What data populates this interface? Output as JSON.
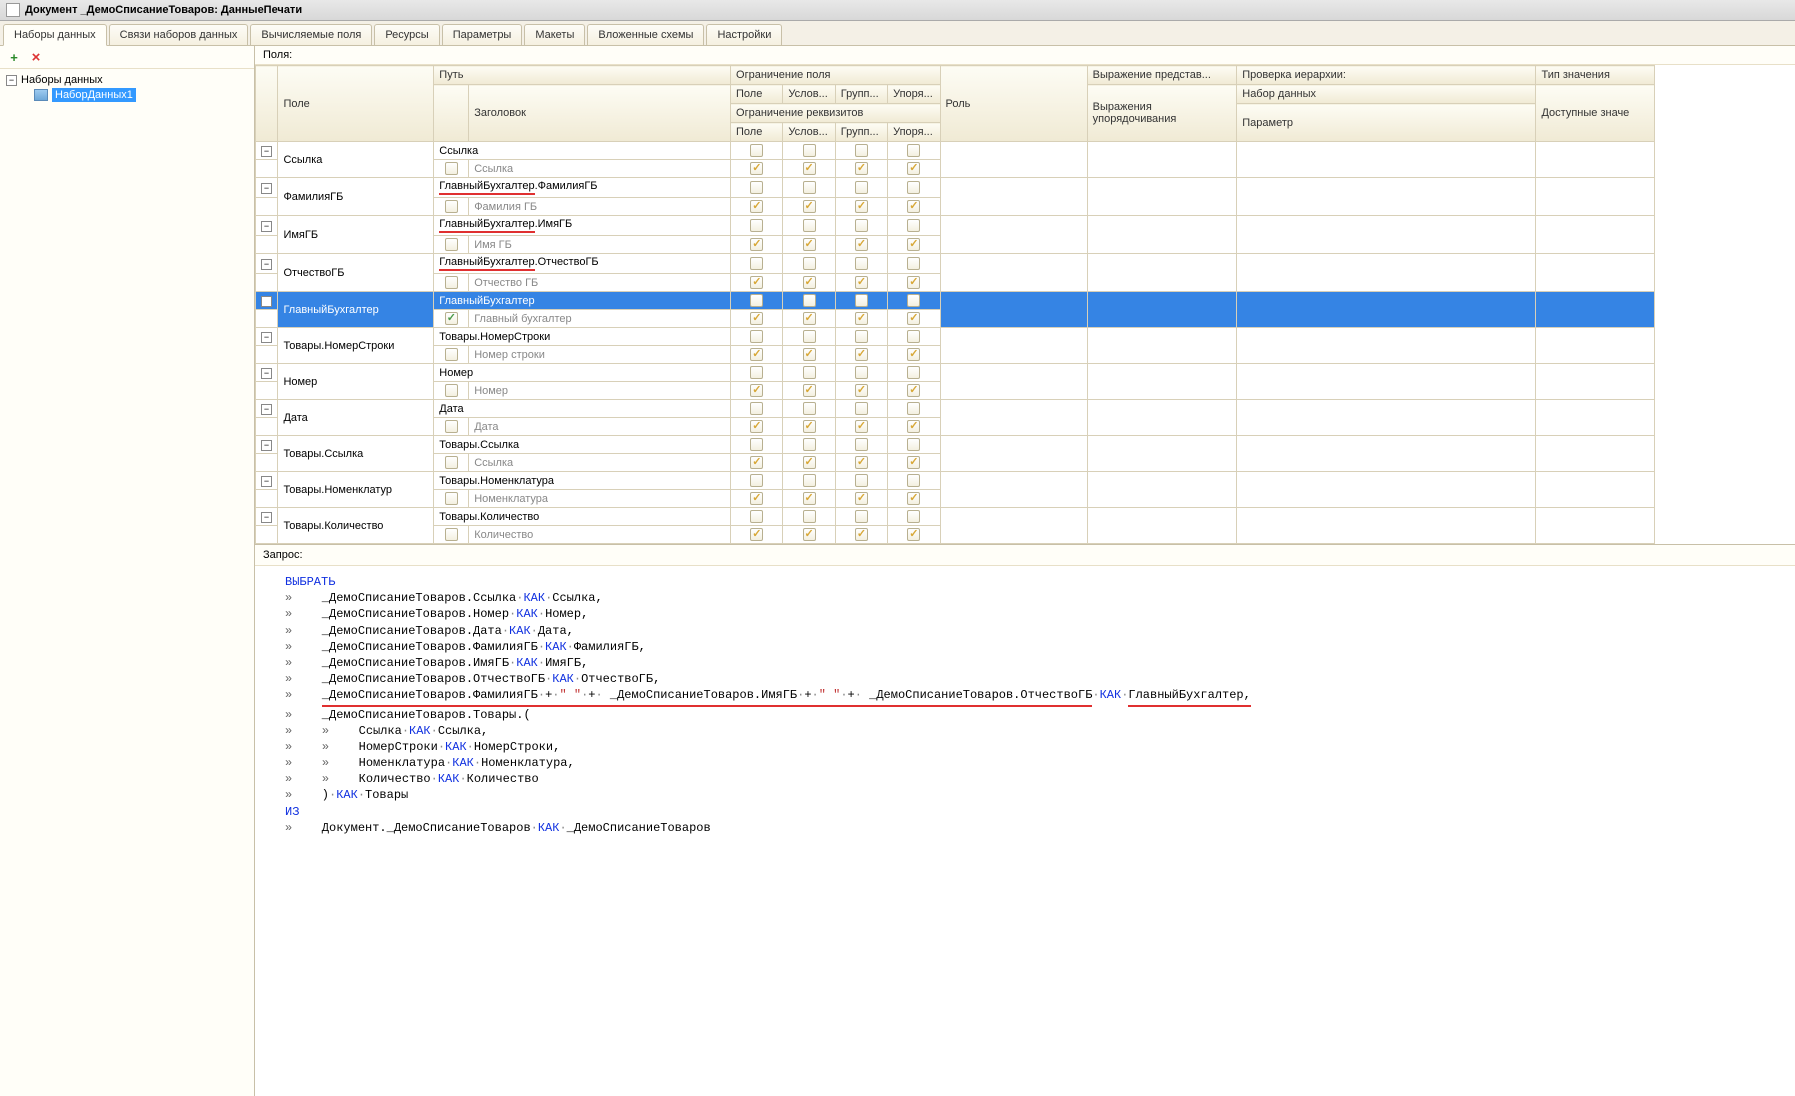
{
  "title": "Документ _ДемоСписаниеТоваров: ДанныеПечати",
  "tabs": [
    "Наборы данных",
    "Связи наборов данных",
    "Вычисляемые поля",
    "Ресурсы",
    "Параметры",
    "Макеты",
    "Вложенные схемы",
    "Настройки"
  ],
  "activeTab": 0,
  "tree": {
    "root": "Наборы данных",
    "child": "НаборДанных1"
  },
  "fieldsLabel": "Поля:",
  "headers": {
    "field": "Поле",
    "path": "Путь",
    "head": "Заголовок",
    "limField": "Ограничение поля",
    "role": "Роль",
    "exprPres": "Выражение представ...",
    "exprOrd": "Выражения упорядочивания",
    "hier": "Проверка иерархии:",
    "ds": "Набор данных",
    "param": "Параметр",
    "type": "Тип значения",
    "avail": "Доступные значе",
    "pole": "Поле",
    "uslov": "Услов...",
    "grupp": "Групп...",
    "uporya": "Упоря...",
    "limReq": "Ограничение реквизитов"
  },
  "rows": [
    {
      "field": "Ссылка",
      "path": "Ссылка",
      "sub": "Ссылка",
      "u": false,
      "cb1": [
        "",
        "",
        "",
        ""
      ],
      "cb2": [
        "c",
        "c",
        "c",
        "c"
      ]
    },
    {
      "field": "ФамилияГБ",
      "path": "ГлавныйБухгалтер.ФамилияГБ",
      "sub": "Фамилия ГБ",
      "u": true,
      "cb1": [
        "",
        "",
        "",
        ""
      ],
      "cb2": [
        "c",
        "c",
        "c",
        "c"
      ]
    },
    {
      "field": "ИмяГБ",
      "path": "ГлавныйБухгалтер.ИмяГБ",
      "sub": "Имя ГБ",
      "u": true,
      "cb1": [
        "",
        "",
        "",
        ""
      ],
      "cb2": [
        "c",
        "c",
        "c",
        "c"
      ]
    },
    {
      "field": "ОтчествоГБ",
      "path": "ГлавныйБухгалтер.ОтчествоГБ",
      "sub": "Отчество ГБ",
      "u": true,
      "cb1": [
        "",
        "",
        "",
        ""
      ],
      "cb2": [
        "c",
        "c",
        "c",
        "c"
      ]
    },
    {
      "field": "ГлавныйБухгалтер",
      "path": "ГлавныйБухгалтер",
      "sub": "Главный бухгалтер",
      "u": false,
      "sel": true,
      "subCheck": true,
      "cb1": [
        "",
        "",
        "",
        ""
      ],
      "cb2": [
        "c",
        "c",
        "c",
        "c"
      ]
    },
    {
      "field": "Товары.НомерСтроки",
      "path": "Товары.НомерСтроки",
      "sub": "Номер строки",
      "u": false,
      "cb1": [
        "",
        "",
        "",
        ""
      ],
      "cb2": [
        "c",
        "c",
        "c",
        "c"
      ]
    },
    {
      "field": "Номер",
      "path": "Номер",
      "sub": "Номер",
      "u": false,
      "cb1": [
        "",
        "",
        "",
        ""
      ],
      "cb2": [
        "c",
        "c",
        "c",
        "c"
      ]
    },
    {
      "field": "Дата",
      "path": "Дата",
      "sub": "Дата",
      "u": false,
      "cb1": [
        "",
        "",
        "",
        ""
      ],
      "cb2": [
        "c",
        "c",
        "c",
        "c"
      ]
    },
    {
      "field": "Товары.Ссылка",
      "path": "Товары.Ссылка",
      "sub": "Ссылка",
      "u": false,
      "cb1": [
        "",
        "",
        "",
        ""
      ],
      "cb2": [
        "c",
        "c",
        "c",
        "c"
      ]
    },
    {
      "field": "Товары.Номенклатур",
      "path": "Товары.Номенклатура",
      "sub": "Номенклатура",
      "u": false,
      "cb1": [
        "",
        "",
        "",
        ""
      ],
      "cb2": [
        "c",
        "c",
        "c",
        "c"
      ]
    },
    {
      "field": "Товары.Количество",
      "path": "Товары.Количество",
      "sub": "Количество",
      "u": false,
      "cb1": [
        "",
        "",
        "",
        ""
      ],
      "cb2": [
        "c",
        "c",
        "c",
        "c"
      ]
    }
  ],
  "queryLabel": "Запрос:",
  "query": {
    "select": "ВЫБРАТЬ",
    "kak": "КАК",
    "iz": "ИЗ",
    "lines": [
      {
        "t": "_ДемоСписаниеТоваров.Ссылка",
        "a": "Ссылка",
        "comma": true
      },
      {
        "t": "_ДемоСписаниеТоваров.Номер",
        "a": "Номер",
        "comma": true
      },
      {
        "t": "_ДемоСписаниеТоваров.Дата",
        "a": "Дата",
        "comma": true
      },
      {
        "t": "_ДемоСписаниеТоваров.ФамилияГБ",
        "a": "ФамилияГБ",
        "comma": true
      },
      {
        "t": "_ДемоСписаниеТоваров.ИмяГБ",
        "a": "ИмяГБ",
        "comma": true
      },
      {
        "t": "_ДемоСписаниеТоваров.ОтчествоГБ",
        "a": "ОтчествоГБ",
        "comma": true
      }
    ],
    "concatLine": {
      "p1": "_ДемоСписаниеТоваров.ФамилияГБ",
      "p2": "_ДемоСписаниеТоваров.ИмяГБ",
      "p3": "_ДемоСписаниеТоваров.ОтчествоГБ",
      "alias": "ГлавныйБухгалтер",
      "sp": "\" \""
    },
    "nested": "_ДемоСписаниеТоваров.Товары.(",
    "nestedLines": [
      {
        "t": "Ссылка",
        "a": "Ссылка",
        "comma": true
      },
      {
        "t": "НомерСтроки",
        "a": "НомерСтроки",
        "comma": true
      },
      {
        "t": "Номенклатура",
        "a": "Номенклатура",
        "comma": true
      },
      {
        "t": "Количество",
        "a": "Количество",
        "comma": false
      }
    ],
    "close": ")",
    "nestedAlias": "Товары",
    "from": "Документ._ДемоСписаниеТоваров",
    "fromAlias": "_ДемоСписаниеТоваров"
  }
}
